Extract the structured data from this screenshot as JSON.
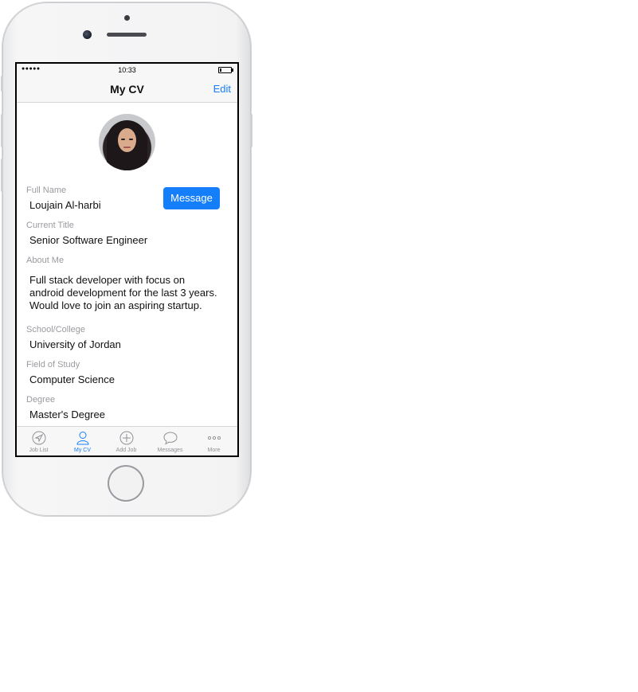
{
  "status_bar": {
    "signal": "●●●●●",
    "time": "10:33",
    "battery_icon": "battery-icon"
  },
  "nav": {
    "title": "My CV",
    "edit_label": "Edit"
  },
  "profile": {
    "avatar_icon": "profile-photo",
    "message_button": "Message",
    "fields": {
      "full_name": {
        "label": "Full Name",
        "value": "Loujain Al-harbi"
      },
      "current_title": {
        "label": "Current Title",
        "value": "Senior Software Engineer"
      },
      "about_me": {
        "label": "About Me",
        "lines": [
          "Full stack developer with focus on",
          "android development for the last 3 years.",
          "Would love to join an aspiring startup."
        ]
      },
      "school": {
        "label": "School/College",
        "value": "University of Jordan"
      },
      "field_of_study": {
        "label": "Field of Study",
        "value": "Computer Science"
      },
      "degree": {
        "label": "Degree",
        "value": "Master's Degree"
      }
    }
  },
  "tabbar": {
    "items": [
      {
        "label": "Job List",
        "icon": "location-arrow-icon"
      },
      {
        "label": "My CV",
        "icon": "person-icon",
        "active": true
      },
      {
        "label": "Add Job",
        "icon": "plus-circle-icon"
      },
      {
        "label": "Messages",
        "icon": "speech-bubble-icon"
      },
      {
        "label": "More",
        "icon": "ellipsis-icon"
      }
    ]
  },
  "colors": {
    "accent": "#157efb",
    "label_gray": "#9a9a9f",
    "bar_bg": "#f7f7f8"
  }
}
